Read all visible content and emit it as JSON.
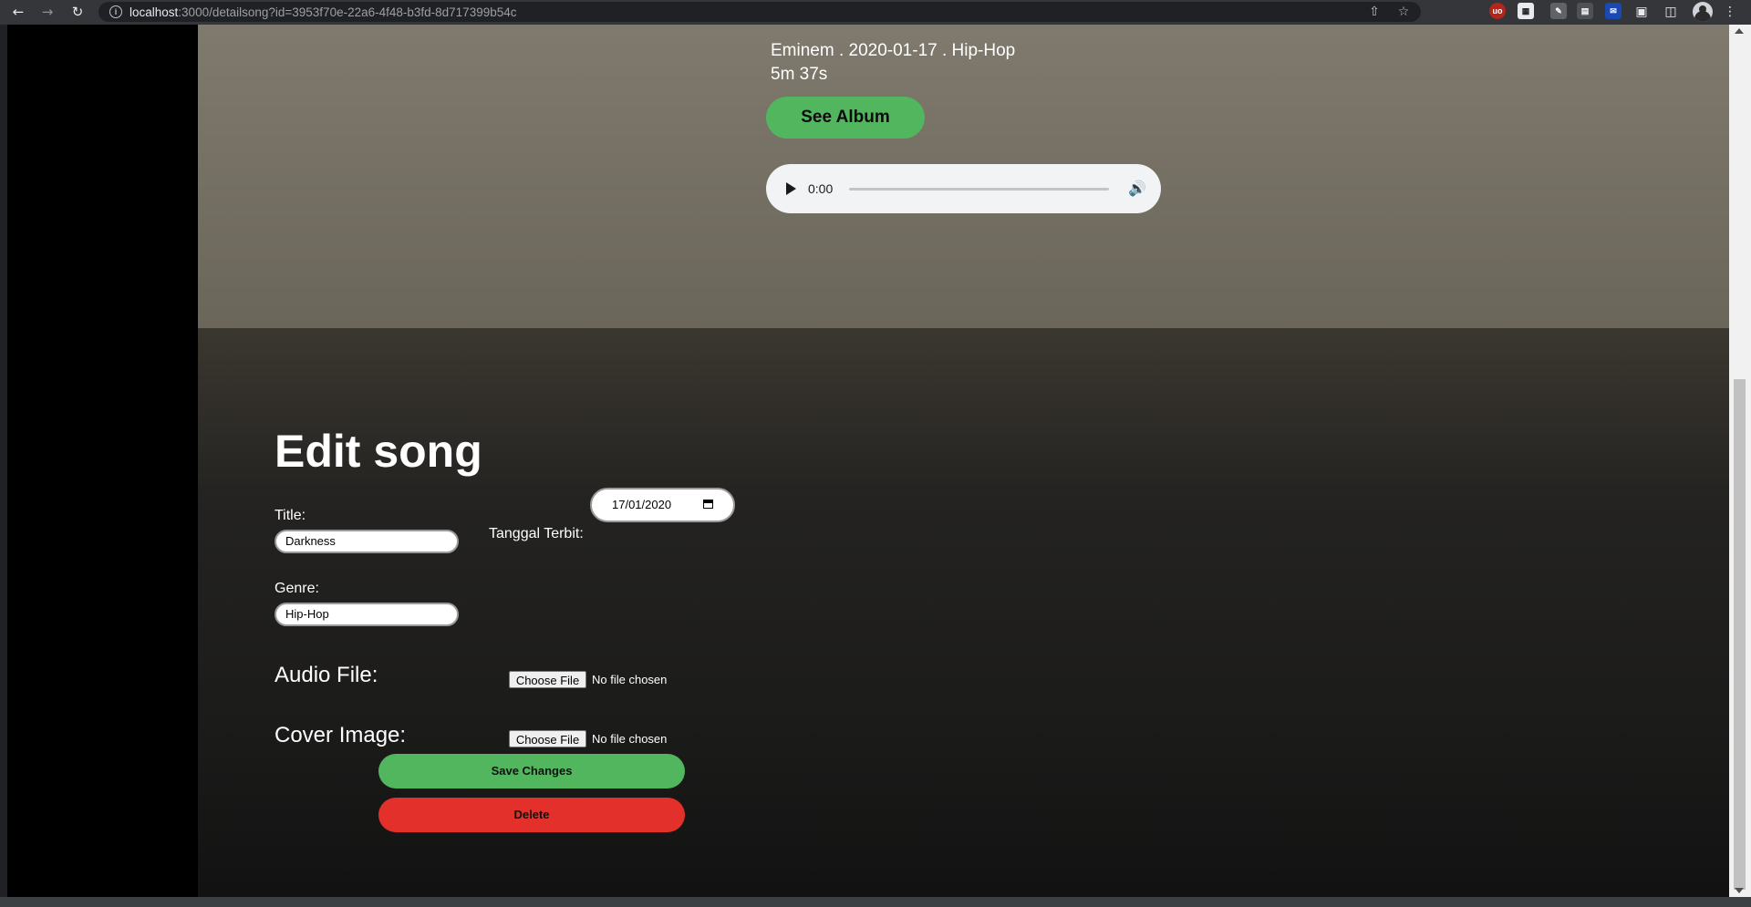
{
  "browser": {
    "url_host": "localhost",
    "url_rest": ":3000/detailsong?id=3953f70e-22a6-4f48-b3fd-8d717399b54c",
    "icons": [
      "back-arrow-icon",
      "forward-arrow-icon",
      "reload-icon",
      "site-info-icon",
      "share-icon",
      "bookmark-star-icon",
      "extensions-icon",
      "side-panel-icon",
      "profile-avatar",
      "more-menu-icon"
    ]
  },
  "song": {
    "meta_line": "Eminem . 2020-01-17 . Hip-Hop",
    "duration": "5m 37s",
    "see_album_label": "See Album"
  },
  "audio_player": {
    "time": "0:00"
  },
  "edit": {
    "heading": "Edit song",
    "title_label": "Title:",
    "title_value": "Darkness",
    "date_label": "Tanggal Terbit:",
    "date_value": "17/01/2020",
    "genre_label": "Genre:",
    "genre_value": "Hip-Hop",
    "audio_label": "Audio File:",
    "cover_label": "Cover Image:",
    "choose_file_label": "Choose File",
    "no_file_text": "No file chosen",
    "save_label": "Save Changes",
    "delete_label": "Delete"
  },
  "colors": {
    "accent_green": "#52b65f",
    "danger_red": "#e4302a",
    "sidebar": "#000000"
  }
}
